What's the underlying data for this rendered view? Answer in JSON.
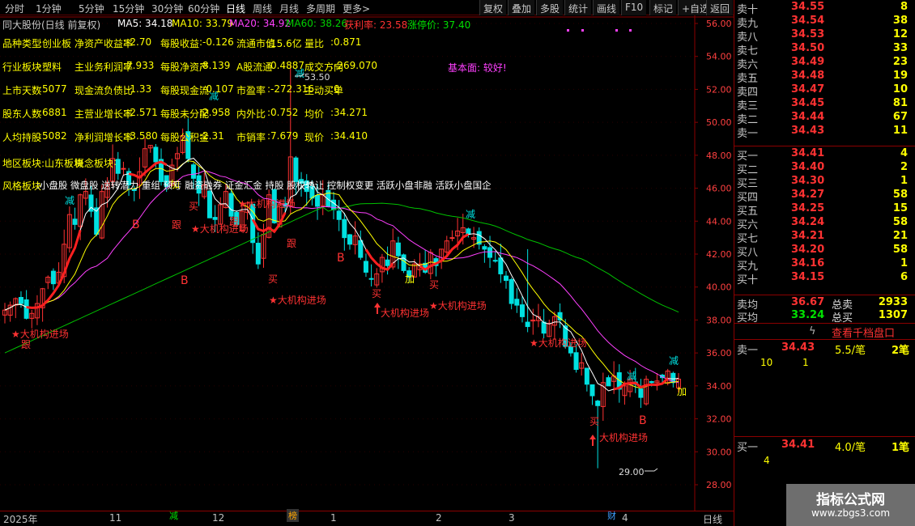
{
  "toolbar": {
    "periods": [
      "分时",
      "1分钟",
      "5分钟",
      "15分钟",
      "30分钟",
      "60分钟",
      "日线",
      "周线",
      "月线",
      "多周期",
      "更多>"
    ],
    "active": "日线",
    "right_buttons": [
      "复权",
      "叠加",
      "多股",
      "统计",
      "画线",
      "F10",
      "标记",
      "+自选",
      "返回"
    ]
  },
  "info_bar": {
    "title": "同大股份(日线 前复权)",
    "ma5": "MA5: 34.18",
    "ma10": "MA10: 33.79",
    "ma20": "MA20: 34.92",
    "ma60": "MA60: 38.26",
    "profit": "获利率: 23.58",
    "stop": "涨停价: 37.40"
  },
  "fundamentals": {
    "r1": [
      "品种类型",
      ":创业板",
      "净资产收益率",
      ":-2.70",
      "每股收益",
      ":-0.126",
      "流通市值",
      ":15.6亿",
      "量比",
      ":0.871"
    ],
    "r2": [
      "行业板块",
      ":塑料",
      "主业务利润率",
      ":7.933",
      "每股净资产",
      ":8.139",
      "A股流通",
      ":0.4887",
      "成交方向",
      ":-269.070"
    ],
    "r3": [
      "上市天数",
      ":5077",
      "现金流负债比",
      ":-1.33",
      "每股现金流",
      ":-0.107",
      "市盈率",
      ":-272.316",
      "主动买单",
      ":0"
    ],
    "r4": [
      "股东人数",
      ":6881",
      "主营业增长率",
      ":-2.571",
      "每股未分配",
      ":2.958",
      "内外比",
      ":0.752",
      "均价",
      ":34.271"
    ],
    "r5": [
      "人均持股",
      ":5082",
      "净利润增长率",
      ":-3.580",
      "每股公积金",
      ":2.31",
      "市销率",
      ":7.679",
      "现价",
      ":34.410"
    ],
    "region": "地区板块",
    "region_val": ":山东板块",
    "concept": "概念板块",
    "concept_val": ":",
    "style": "风格板块",
    "style_val": ":小盘股 微盘股 送转潜力 重组 预亏 融资融券 证金汇金 持股 股权转让 控制权变更 活跃小盘非融 活跃小盘国企",
    "fund_note": "基本面: 较好!"
  },
  "y_axis": [
    "56.00",
    "54.00",
    "52.00",
    "50.00",
    "48.00",
    "46.00",
    "44.00",
    "42.00",
    "40.00",
    "38.00",
    "36.00",
    "34.00",
    "32.00",
    "30.00",
    "28.00"
  ],
  "chart_data": {
    "type": "line",
    "x_labels": [
      "2025年",
      "11",
      "12",
      "1",
      "2",
      "3",
      "4"
    ],
    "y_range": [
      28,
      56
    ],
    "annotations": {
      "high": "53.50",
      "low": "29.00",
      "sig_buy": "买",
      "sig_follow": "跟",
      "sig_add": "加",
      "sig_reduce": "减",
      "sig_b": "B",
      "inst": "★大机构进场",
      "inst_plain": "大机构进场"
    },
    "close": [
      38.6,
      38.9,
      39.3,
      39.0,
      38.1,
      38.4,
      39.0,
      39.9,
      40.6,
      40.2,
      40.9,
      42.6,
      44.4,
      43.8,
      45.6,
      45.8,
      44.6,
      43.2,
      45.8,
      46.3,
      47.8,
      46.9,
      47.2,
      46.2,
      45.9,
      47.0,
      48.4,
      48.6,
      47.6,
      46.4,
      46.1,
      47.4,
      48.1,
      49.2,
      47.8,
      46.6,
      45.7,
      46.2,
      44.2,
      44.1,
      45.0,
      45.8,
      44.3,
      43.8,
      44.6,
      45.1,
      42.7,
      41.4,
      43.2,
      45.6,
      43.9,
      45.0,
      44.9,
      47.9,
      46.4,
      46.3,
      45.8,
      45.4,
      44.9,
      45.6,
      44.9,
      44.7,
      44.1,
      43.0,
      42.6,
      43.1,
      41.8,
      40.9,
      40.5,
      40.8,
      41.8,
      41.3,
      42.8,
      41.9,
      41.0,
      40.6,
      41.4,
      41.4,
      40.9,
      42.1,
      41.3,
      42.3,
      42.8,
      43.0,
      43.4,
      43.6,
      43.2,
      43.0,
      42.6,
      42.3,
      41.8,
      41.6,
      40.8,
      40.4,
      39.0,
      38.9,
      38.2,
      37.6,
      38.0,
      38.2,
      37.2,
      37.8,
      38.2,
      38.0,
      36.4,
      36.0,
      35.0,
      35.4,
      34.1,
      33.4,
      32.8,
      34.2,
      34.0,
      34.6,
      33.8,
      34.0,
      34.4,
      34.1,
      33.3,
      34.4,
      34.2,
      34.3,
      34.5,
      34.9,
      34.2,
      34.41
    ],
    "ma5": "MA5",
    "ma10": "MA10",
    "ma20": "MA20",
    "ma60": "MA60"
  },
  "bottom": {
    "period": "日线",
    "events": [
      "减",
      "榜",
      "财"
    ]
  },
  "orderbook": {
    "asks": [
      {
        "label": "卖十",
        "price": "34.55",
        "vol": "8"
      },
      {
        "label": "卖九",
        "price": "34.54",
        "vol": "38"
      },
      {
        "label": "卖八",
        "price": "34.53",
        "vol": "12"
      },
      {
        "label": "卖七",
        "price": "34.50",
        "vol": "33"
      },
      {
        "label": "卖六",
        "price": "34.49",
        "vol": "23"
      },
      {
        "label": "卖五",
        "price": "34.48",
        "vol": "19"
      },
      {
        "label": "卖四",
        "price": "34.47",
        "vol": "10"
      },
      {
        "label": "卖三",
        "price": "34.45",
        "vol": "81"
      },
      {
        "label": "卖二",
        "price": "34.44",
        "vol": "67"
      },
      {
        "label": "卖一",
        "price": "34.43",
        "vol": "11"
      }
    ],
    "bids": [
      {
        "label": "买一",
        "price": "34.41",
        "vol": "4"
      },
      {
        "label": "买二",
        "price": "34.40",
        "vol": "2"
      },
      {
        "label": "买三",
        "price": "34.30",
        "vol": "1"
      },
      {
        "label": "买四",
        "price": "34.27",
        "vol": "58"
      },
      {
        "label": "买五",
        "price": "34.25",
        "vol": "15"
      },
      {
        "label": "买六",
        "price": "34.24",
        "vol": "58"
      },
      {
        "label": "买七",
        "price": "34.21",
        "vol": "21"
      },
      {
        "label": "买八",
        "price": "34.20",
        "vol": "58"
      },
      {
        "label": "买九",
        "price": "34.16",
        "vol": "1"
      },
      {
        "label": "买十",
        "price": "34.15",
        "vol": "6"
      }
    ],
    "avg_sell_label": "卖均",
    "avg_sell": "36.67",
    "total_sell_label": "总卖",
    "total_sell": "2933",
    "avg_buy_label": "买均",
    "avg_buy": "33.24",
    "total_buy_label": "总买",
    "total_buy": "1307",
    "thousand_btn": "查看千档盘口",
    "ask1_label": "卖一",
    "ask1_price": "34.43",
    "ask1_per": "5.5/笔",
    "ask1_cnt": "2笔",
    "ask1_queue": [
      "10",
      "1"
    ],
    "bid1_label": "买一",
    "bid1_price": "34.41",
    "bid1_per": "4.0/笔",
    "bid1_cnt": "1笔",
    "bid1_queue": [
      "4"
    ]
  },
  "watermark": {
    "title": "指标公式网",
    "url": "www.zbgs3.com"
  },
  "colors": {
    "up": "#ff3232",
    "down": "#00e0e0",
    "ma5": "#ffffff",
    "ma10": "#ffff00",
    "ma20": "#ff40ff",
    "ma60": "#00c000",
    "grid": "#8b0000"
  }
}
